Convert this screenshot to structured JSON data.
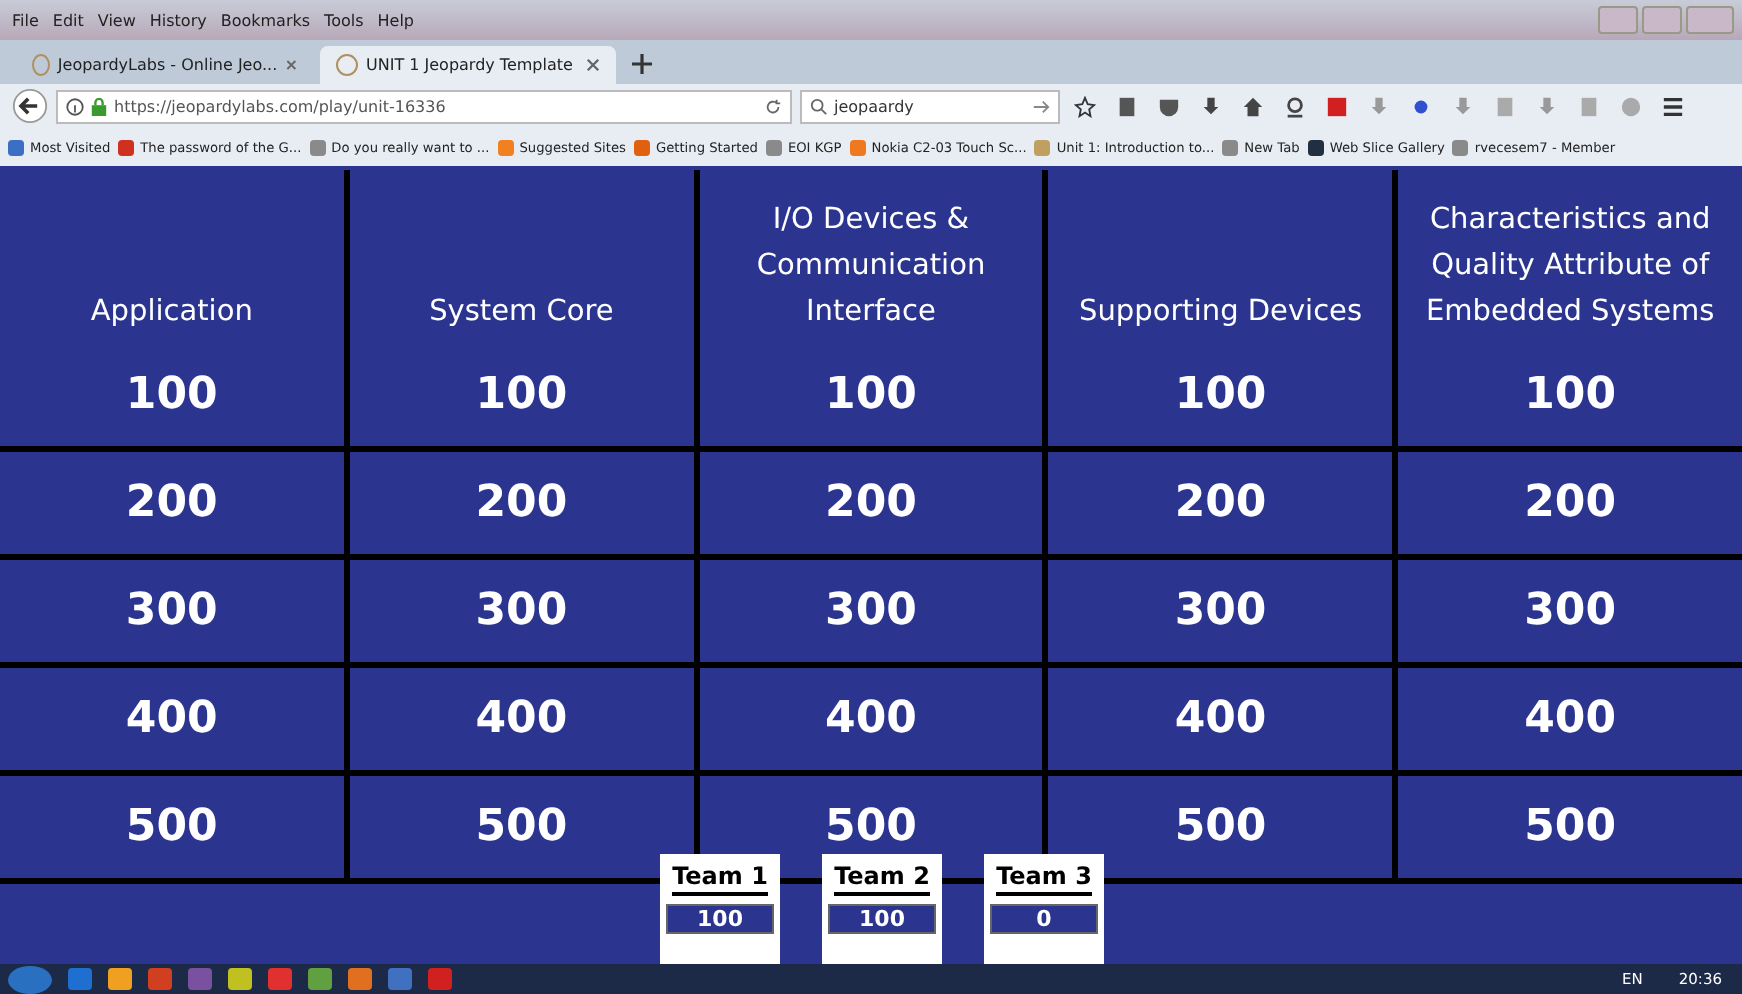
{
  "menu": [
    "File",
    "Edit",
    "View",
    "History",
    "Bookmarks",
    "Tools",
    "Help"
  ],
  "tabs": [
    {
      "label": "JeopardyLabs - Online Jeo...",
      "selected": false
    },
    {
      "label": "UNIT 1 Jeopardy Template",
      "selected": true
    }
  ],
  "address": {
    "value": "https://jeopardylabs.com/play/unit-16336"
  },
  "search": {
    "value": "jeopaardy"
  },
  "bookmarks": [
    {
      "label": "Most Visited",
      "color": "#3a6fc4"
    },
    {
      "label": "The password of the G...",
      "color": "#d03020"
    },
    {
      "label": "Do you really want to ...",
      "color": "#8a8a8a"
    },
    {
      "label": "Suggested Sites",
      "color": "#f08020"
    },
    {
      "label": "Getting Started",
      "color": "#e06010"
    },
    {
      "label": "EOI KGP",
      "color": "#8a8a8a"
    },
    {
      "label": "Nokia C2-03 Touch Sc...",
      "color": "#f07820"
    },
    {
      "label": "Unit 1: Introduction to...",
      "color": "#c0a060"
    },
    {
      "label": "New Tab",
      "color": "#8a8a8a"
    },
    {
      "label": "Web Slice Gallery",
      "color": "#203040"
    },
    {
      "label": "rvecesem7 - Member",
      "color": "#8a8a8a"
    }
  ],
  "board": {
    "categories": [
      "Application",
      "System Core",
      "I/O Devices & Communication Interface",
      "Supporting Devices",
      "Characteristics and Quality Attribute of Embedded Systems"
    ],
    "rows": [
      [
        "100",
        "100",
        "100",
        "100",
        "100"
      ],
      [
        "200",
        "200",
        "200",
        "200",
        "200"
      ],
      [
        "300",
        "300",
        "300",
        "300",
        "300"
      ],
      [
        "400",
        "400",
        "400",
        "400",
        "400"
      ],
      [
        "500",
        "500",
        "500",
        "500",
        "500"
      ]
    ]
  },
  "teams": [
    {
      "name": "Team 1",
      "score": "100"
    },
    {
      "name": "Team 2",
      "score": "100"
    },
    {
      "name": "Team 3",
      "score": "0"
    }
  ],
  "taskbar": {
    "language": "EN",
    "time": "20:36"
  }
}
